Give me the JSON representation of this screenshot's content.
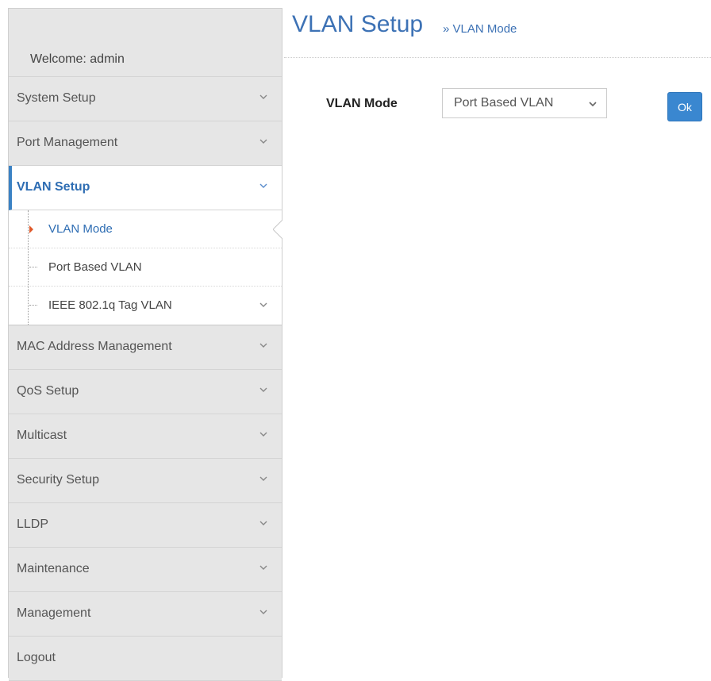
{
  "sidebar": {
    "welcome": "Welcome: admin",
    "items_top": [
      {
        "label": "System Setup"
      },
      {
        "label": "Port Management"
      }
    ],
    "active_item": {
      "label": "VLAN Setup"
    },
    "submenu": [
      {
        "label": "VLAN Mode"
      },
      {
        "label": "Port Based VLAN"
      },
      {
        "label": "IEEE 802.1q Tag VLAN"
      }
    ],
    "items_bottom": [
      {
        "label": "MAC Address Management"
      },
      {
        "label": "QoS Setup"
      },
      {
        "label": "Multicast"
      },
      {
        "label": "Security Setup"
      },
      {
        "label": "LLDP"
      },
      {
        "label": "Maintenance"
      },
      {
        "label": "Management"
      },
      {
        "label": "Logout"
      }
    ]
  },
  "header": {
    "title": "VLAN Setup",
    "breadcrumb": "» VLAN Mode"
  },
  "form": {
    "vlan_mode_label": "VLAN Mode",
    "vlan_mode_value": "Port Based VLAN",
    "ok_label": "Ok"
  },
  "colors": {
    "accent": "#3d72b5",
    "button": "#3a87d0",
    "sidebar_bg": "#e6e6e6",
    "marker": "#e0592a"
  },
  "icons": {
    "chevron": "chevron-down-icon",
    "marker": "arrow-right-icon"
  }
}
